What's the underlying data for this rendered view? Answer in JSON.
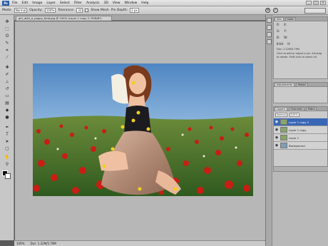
{
  "app": {
    "badge": "Ps"
  },
  "menu": [
    "File",
    "Edit",
    "Image",
    "Layer",
    "Select",
    "Filter",
    "Analysis",
    "3D",
    "View",
    "Window",
    "Help"
  ],
  "window_controls": [
    "_",
    "□",
    "×"
  ],
  "options_bar": {
    "mode_label": "Mode:",
    "mode_value": "Normal",
    "opacity_label": "Opacity:",
    "opacity_value": "100%",
    "tolerance_label": "Tolerance:",
    "tolerance_value": "32",
    "sample_label": "Show Mesh",
    "pins_label": "Pin Depth:",
    "expansion_value": "2 px"
  },
  "document_tab": {
    "title": "girl_with_a_poppy_field.jpg @ 100% (Layer 1 copy 2, RGB/8*)"
  },
  "status": {
    "zoom": "100%",
    "doc": "Doc: 1.22M/5.79M"
  },
  "panels": {
    "info_tab": "Info",
    "color_tab": "Color",
    "info_rows": [
      {
        "a": "R:",
        "b": "X:"
      },
      {
        "a": "G:",
        "b": "Y:"
      },
      {
        "a": "B:",
        "b": "W:"
      },
      {
        "a": "8-bit",
        "b": "H:"
      }
    ],
    "doc_info": "Doc: 1.22M/5.79M",
    "info_note": "Click to add or adjust a pin. Alt-drag to rotate. Shift-click to select all.",
    "adj_tabs": [
      "Adjustments",
      "Masks"
    ],
    "layer_tabs": [
      "Layers",
      "Channels",
      "Paths"
    ],
    "blend_mode": "Normal",
    "opacity": "100%",
    "layers": [
      {
        "name": "Layer 1 copy 2",
        "selected": true
      },
      {
        "name": "Layer 1 copy",
        "selected": false
      },
      {
        "name": "Layer 1",
        "selected": false
      },
      {
        "name": "Background",
        "selected": false
      }
    ]
  }
}
